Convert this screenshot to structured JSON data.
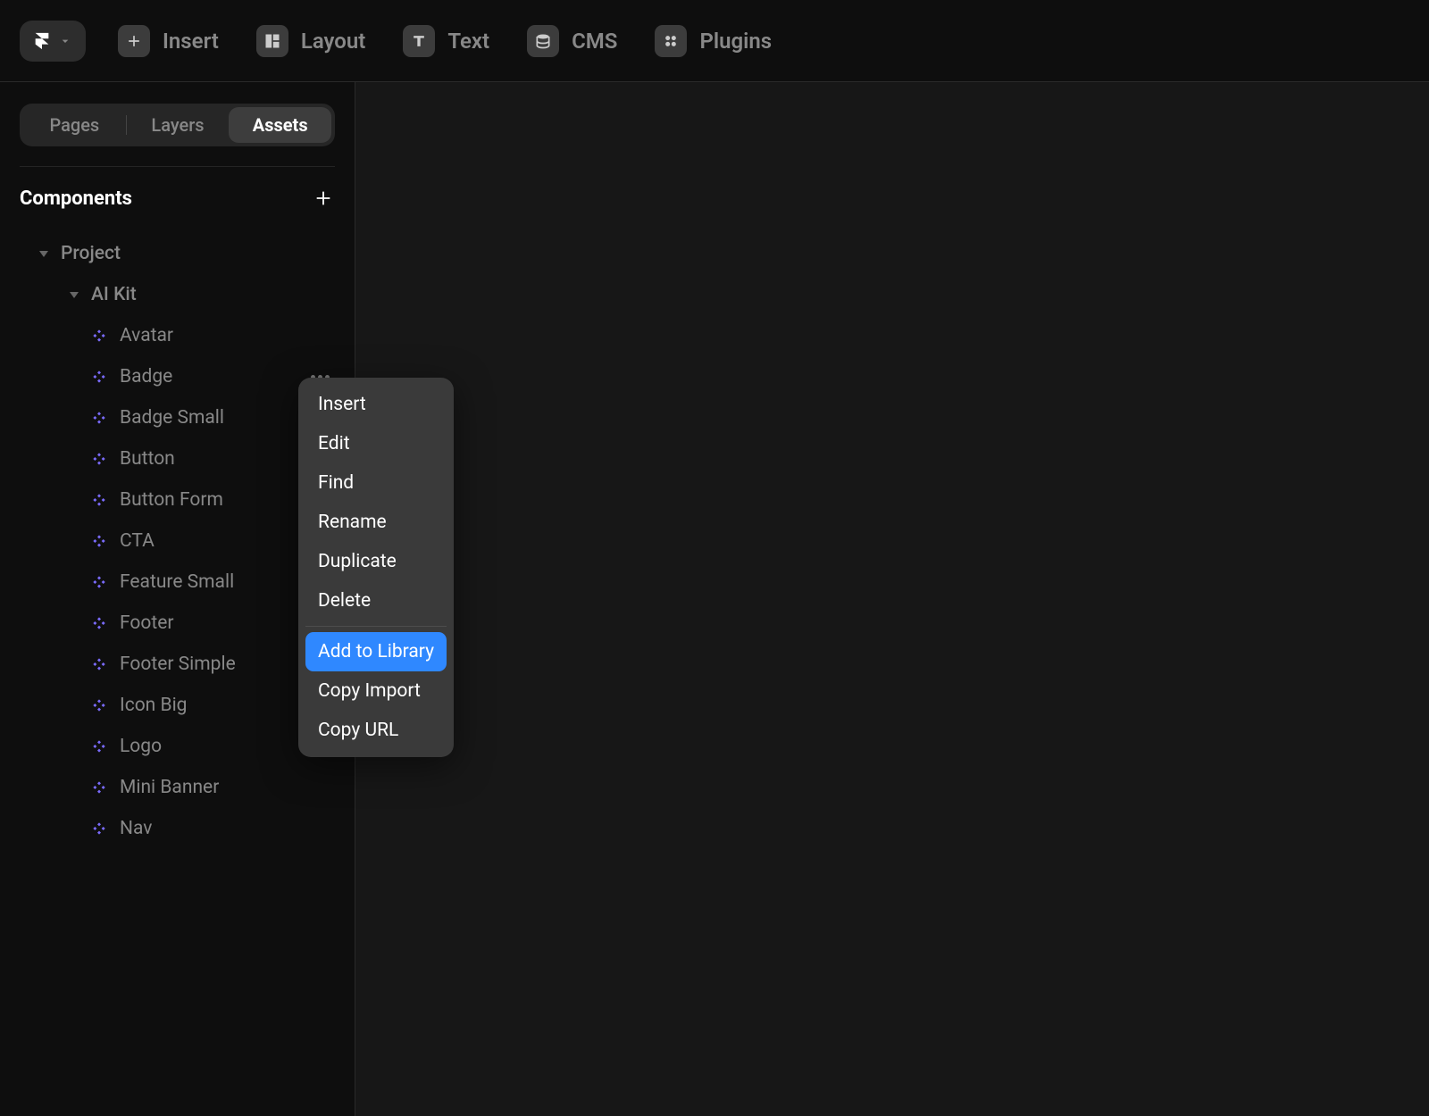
{
  "toolbar": {
    "insert": "Insert",
    "layout": "Layout",
    "text": "Text",
    "cms": "CMS",
    "plugins": "Plugins"
  },
  "sidebar_tabs": {
    "pages": "Pages",
    "layers": "Layers",
    "assets": "Assets"
  },
  "components": {
    "section_title": "Components",
    "tree": {
      "root": "Project",
      "group": "AI Kit",
      "items": [
        "Avatar",
        "Badge",
        "Badge Small",
        "Button",
        "Button Form",
        "CTA",
        "Feature Small",
        "Footer",
        "Footer Simple",
        "Icon Big",
        "Logo",
        "Mini Banner",
        "Nav"
      ]
    }
  },
  "context_menu": {
    "items_top": [
      "Insert",
      "Edit",
      "Find",
      "Rename",
      "Duplicate",
      "Delete"
    ],
    "items_bottom": [
      "Add to Library",
      "Copy Import",
      "Copy URL"
    ],
    "highlighted": "Add to Library"
  },
  "colors": {
    "accent_blue": "#2f88ff",
    "component_purple": "#7b6cff"
  }
}
